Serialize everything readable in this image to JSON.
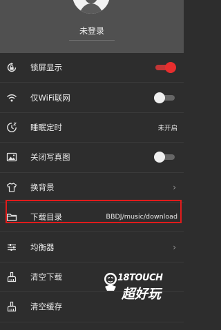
{
  "header": {
    "login_label": "未登录"
  },
  "menu": {
    "items": [
      {
        "label": "锁屏显示",
        "icon": "lock-rotate-icon",
        "control": "toggle",
        "toggle_on": true,
        "accent": "#e82e2e"
      },
      {
        "label": "仅WiFi联网",
        "icon": "wifi-icon",
        "control": "toggle",
        "toggle_on": false
      },
      {
        "label": "睡眠定时",
        "icon": "sleep-timer-icon",
        "control": "value",
        "value": "未开启"
      },
      {
        "label": "关闭写真图",
        "icon": "image-icon",
        "control": "toggle",
        "toggle_on": false
      },
      {
        "label": "换背景",
        "icon": "shirt-icon",
        "control": "chevron",
        "chevron": "›"
      },
      {
        "label": "下载目录",
        "icon": "folder-icon",
        "control": "value",
        "value": "BBDJ/music/download",
        "highlighted": true,
        "highlight_color": "#e21b1b"
      },
      {
        "label": "均衡器",
        "icon": "equalizer-icon",
        "control": "chevron",
        "chevron": "›"
      },
      {
        "label": "清空下载",
        "icon": "broom-icon",
        "control": "none"
      },
      {
        "label": "清空缓存",
        "icon": "broom-icon",
        "control": "none"
      }
    ]
  },
  "watermark": {
    "line1": "18TOUCH",
    "line2": "超好玩"
  }
}
